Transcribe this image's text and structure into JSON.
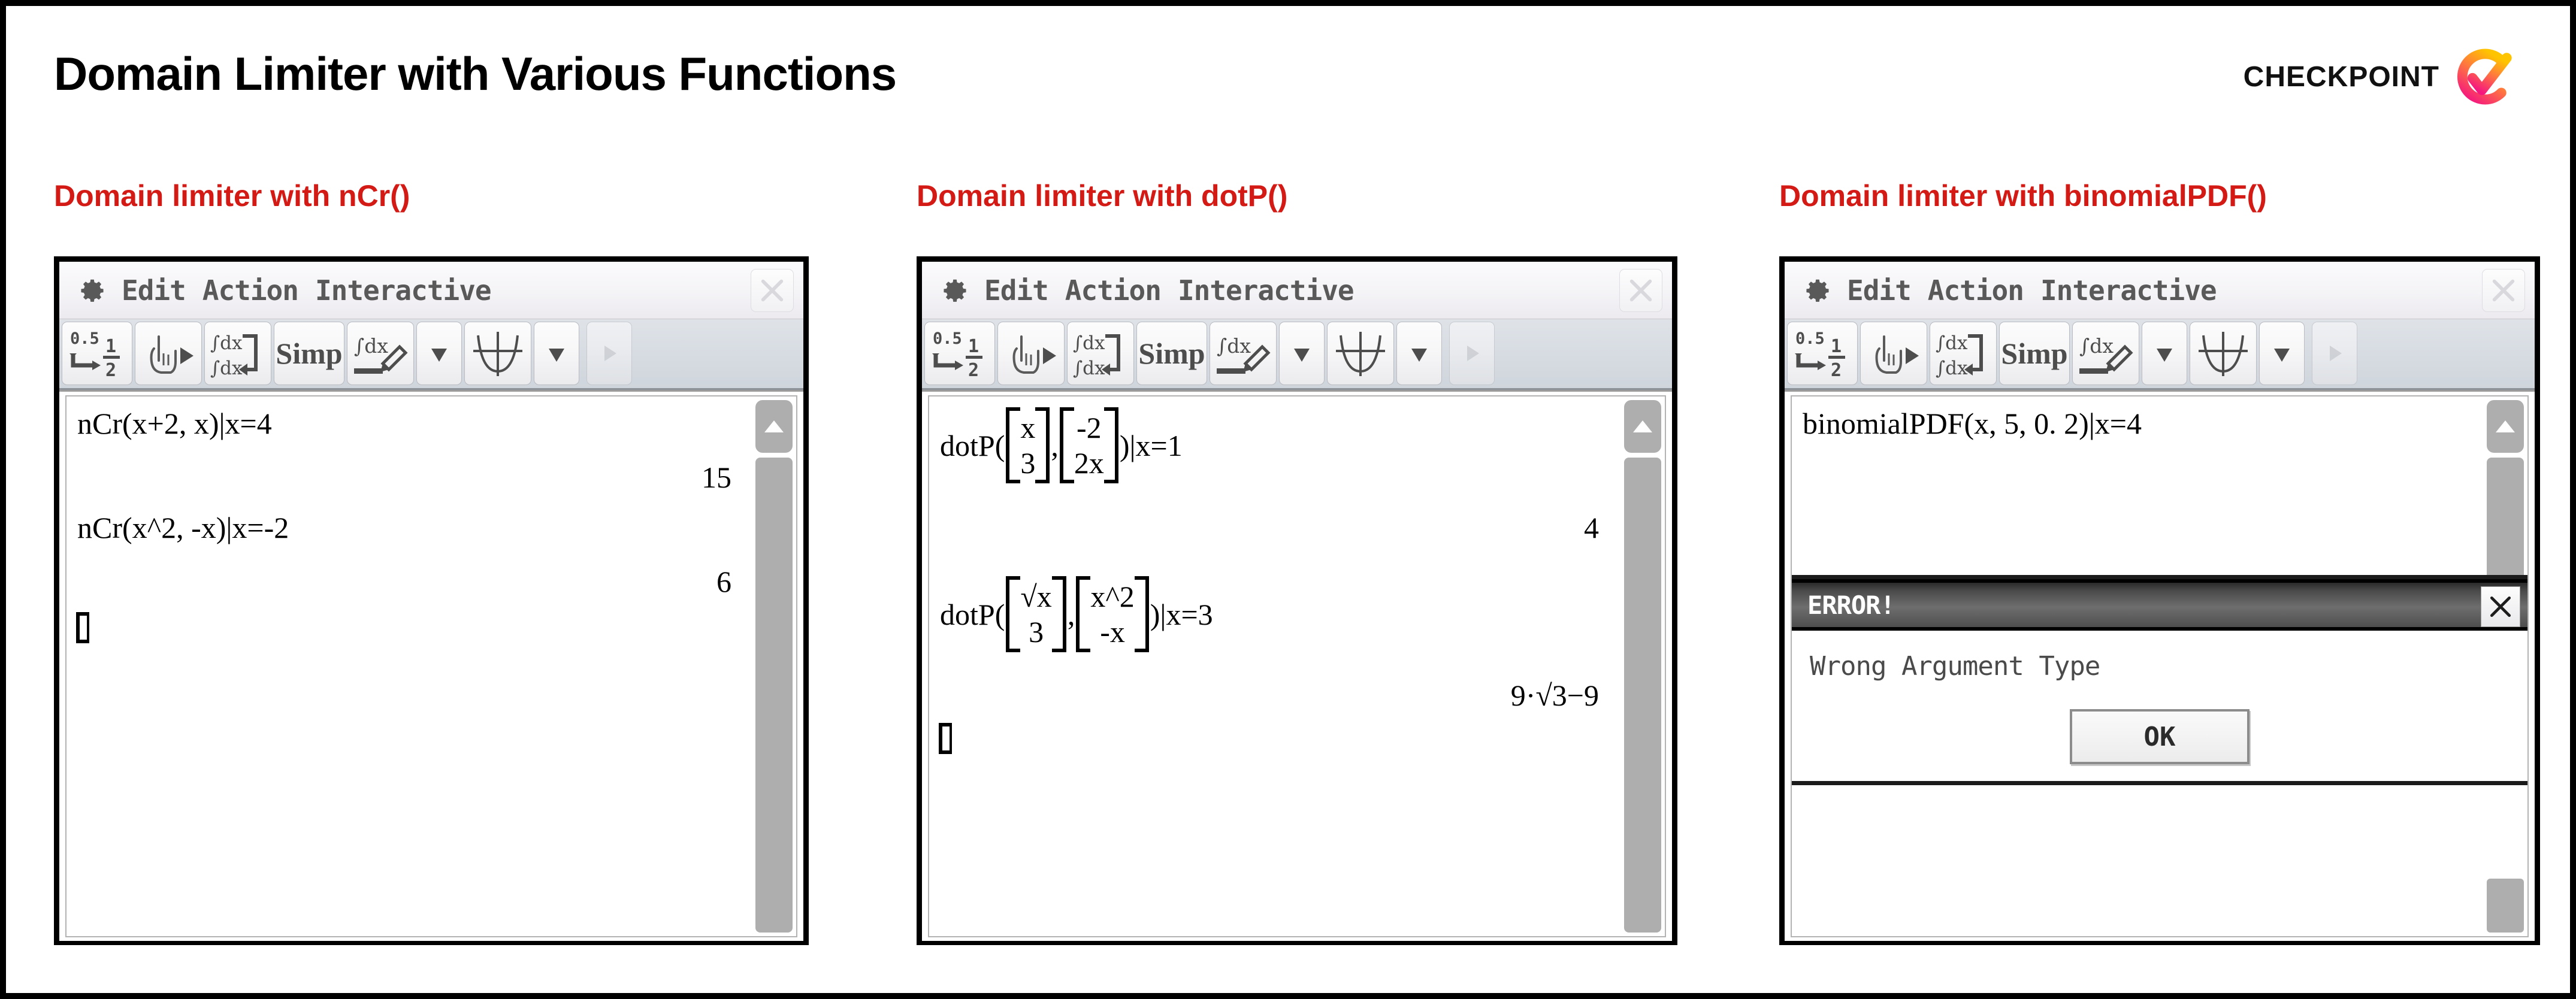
{
  "header": {
    "title": "Domain Limiter with Various Functions",
    "brand_text": "CHECKPOINT",
    "brand_icon": "checkmark-circle-logo",
    "brand_colors": {
      "start": "#ffc400",
      "mid": "#ff7a3d",
      "end": "#f5177f"
    }
  },
  "theme": {
    "heading_red": "#d31a15",
    "panel_border": "#000000",
    "scrollbar_gray": "#aeaeae",
    "error_titlebar": "#5a5a5a"
  },
  "menu": {
    "gear_icon": "gear-icon",
    "items": [
      "Edit",
      "Action",
      "Interactive"
    ],
    "close_icon": "close-icon"
  },
  "toolbar": {
    "buttons": [
      {
        "name": "decimal-fraction-toggle",
        "icon": "0.5-to-half-icon",
        "label": "0.5 1/2"
      },
      {
        "name": "cursor-mode",
        "icon": "hand-pointer-icon",
        "label": ""
      },
      {
        "name": "calc-toggle",
        "icon": "integral-swap-icon",
        "label": ""
      },
      {
        "name": "simplify",
        "icon": "simp-icon",
        "label": "Simp"
      },
      {
        "name": "interactive-edit",
        "icon": "integral-pencil-icon",
        "label": ""
      },
      {
        "name": "dropdown-1",
        "icon": "chevron-down-icon",
        "label": ""
      },
      {
        "name": "graph",
        "icon": "graph-curve-icon",
        "label": ""
      },
      {
        "name": "dropdown-2",
        "icon": "chevron-down-icon",
        "label": ""
      },
      {
        "name": "next-page",
        "icon": "play-right-icon",
        "label": ""
      }
    ]
  },
  "sections": [
    {
      "heading": "Domain limiter with nCr()",
      "panel_name": "calculator-panel-ncr",
      "lines": [
        {
          "type": "expression",
          "text": "nCr(x+2, x)|x=4"
        },
        {
          "type": "result",
          "text": "15"
        },
        {
          "type": "expression",
          "text": "nCr(x^2, -x)|x=-2"
        },
        {
          "type": "result",
          "text": "6"
        }
      ],
      "cursor": true,
      "error": null
    },
    {
      "heading": "Domain limiter with dotP()",
      "panel_name": "calculator-panel-dotp",
      "lines": [
        {
          "type": "expression-matrix",
          "prefix": "dotP(",
          "m1": [
            "x",
            "3"
          ],
          "sep": ",",
          "m2": [
            "-2",
            "2x"
          ],
          "suffix": ")|x=1"
        },
        {
          "type": "result",
          "text": "4"
        },
        {
          "type": "expression-matrix",
          "prefix": "dotP(",
          "m1": [
            "√x",
            "3"
          ],
          "sep": ",",
          "m2": [
            "x^2",
            "-x"
          ],
          "suffix": ")|x=3"
        },
        {
          "type": "result",
          "text": "9·√3−9"
        }
      ],
      "cursor": true,
      "error": null
    },
    {
      "heading": "Domain limiter with binomialPDF()",
      "panel_name": "calculator-panel-binomialpdf",
      "lines": [
        {
          "type": "expression",
          "text": "binomialPDF(x, 5, 0. 2)|x=4"
        }
      ],
      "cursor": false,
      "error": {
        "title": "ERROR!",
        "message": "Wrong Argument Type",
        "ok_label": "OK",
        "close_icon": "close-icon"
      }
    }
  ]
}
